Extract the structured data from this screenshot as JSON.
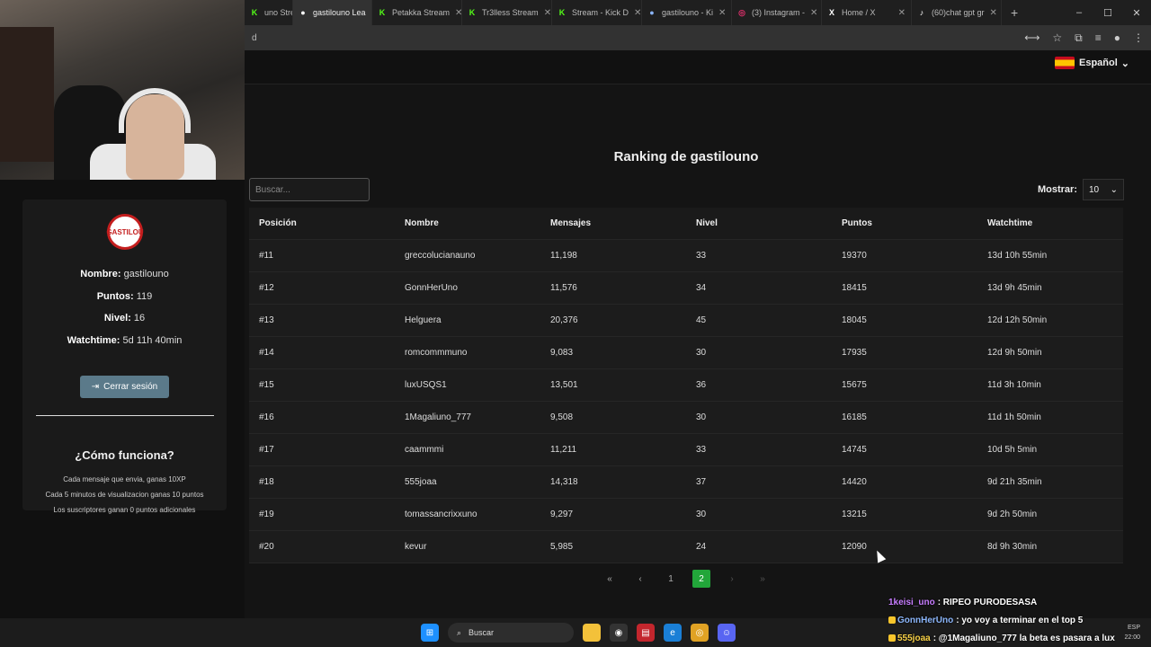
{
  "browser": {
    "tabs": [
      {
        "label": "uno Stre",
        "icon": "kick-icon",
        "color": "#53fc18",
        "active": false
      },
      {
        "label": "gastilouno Lea",
        "icon": "site-icon",
        "color": "#ffffff",
        "active": true
      },
      {
        "label": "Petakka Stream",
        "icon": "kick-icon",
        "color": "#53fc18",
        "active": false
      },
      {
        "label": "Tr3lless Stream",
        "icon": "kick-icon",
        "color": "#53fc18",
        "active": false
      },
      {
        "label": "Stream - Kick D",
        "icon": "kick-icon",
        "color": "#53fc18",
        "active": false
      },
      {
        "label": "gastilouno - Ki",
        "icon": "globe-icon",
        "color": "#8ab4f8",
        "active": false
      },
      {
        "label": "(3) Instagram -",
        "icon": "instagram-icon",
        "color": "#e1306c",
        "active": false
      },
      {
        "label": "Home / X",
        "icon": "x-icon",
        "color": "#ffffff",
        "active": false
      },
      {
        "label": "(60)chat gpt gr",
        "icon": "tiktok-icon",
        "color": "#ffffff",
        "active": false
      }
    ],
    "address_text": "d"
  },
  "header": {
    "language": "Español"
  },
  "ranking": {
    "title": "Ranking de gastilouno",
    "search_placeholder": "Buscar...",
    "show_label": "Mostrar:",
    "show_value": "10",
    "columns": [
      "Posición",
      "Nombre",
      "Mensajes",
      "Nivel",
      "Puntos",
      "Watchtime"
    ],
    "rows": [
      [
        "#11",
        "greccolucianauno",
        "11,198",
        "33",
        "19370",
        "13d 10h 55min"
      ],
      [
        "#12",
        "GonnHerUno",
        "11,576",
        "34",
        "18415",
        "13d 9h 45min"
      ],
      [
        "#13",
        "Helguera",
        "20,376",
        "45",
        "18045",
        "12d 12h 50min"
      ],
      [
        "#14",
        "romcommmuno",
        "9,083",
        "30",
        "17935",
        "12d 9h 50min"
      ],
      [
        "#15",
        "luxUSQS1",
        "13,501",
        "36",
        "15675",
        "11d 3h 10min"
      ],
      [
        "#16",
        "1Magaliuno_777",
        "9,508",
        "30",
        "16185",
        "11d 1h 50min"
      ],
      [
        "#17",
        "caammmi",
        "11,211",
        "33",
        "14745",
        "10d 5h 5min"
      ],
      [
        "#18",
        "555joaa",
        "14,318",
        "37",
        "14420",
        "9d 21h 35min"
      ],
      [
        "#19",
        "tomassancrixxuno",
        "9,297",
        "30",
        "13215",
        "9d 2h 50min"
      ],
      [
        "#20",
        "kevur",
        "5,985",
        "24",
        "12090",
        "8d 9h 30min"
      ]
    ],
    "pagination": {
      "first": "«",
      "prev": "‹",
      "pages": [
        "1",
        "2"
      ],
      "current": "2",
      "next": "›",
      "last": "»"
    }
  },
  "profile": {
    "avatar_text": "GASTILOU",
    "name_label": "Nombre:",
    "name": "gastilouno",
    "points_label": "Puntos:",
    "points": "119",
    "level_label": "Nivel:",
    "level": "16",
    "watchtime_label": "Watchtime:",
    "watchtime": "5d 11h 40min",
    "logout_label": "Cerrar sesión"
  },
  "how_it_works": {
    "title": "¿Cómo funciona?",
    "lines": [
      "Cada mensaje que envia, ganas 10XP",
      "Cada 5 minutos de visualizacion ganas 10 puntos",
      "Los suscriptores ganan 0 puntos adicionales"
    ]
  },
  "taskbar": {
    "search_label": "Buscar",
    "tray_lang": "ESP",
    "tray_time": "22:00"
  },
  "chat": [
    {
      "user": "1keisi_uno",
      "user_color": "#c77dff",
      "message": ": RIPEO PURODESASA"
    },
    {
      "user": "GonnHerUno",
      "user_color": "#8ab4f8",
      "message": ": yo voy a terminar en el top 5"
    },
    {
      "user": "555joaa",
      "user_color": "#f7d046",
      "message": ": @1Magaliuno_777 la beta es pasara a lux"
    }
  ]
}
